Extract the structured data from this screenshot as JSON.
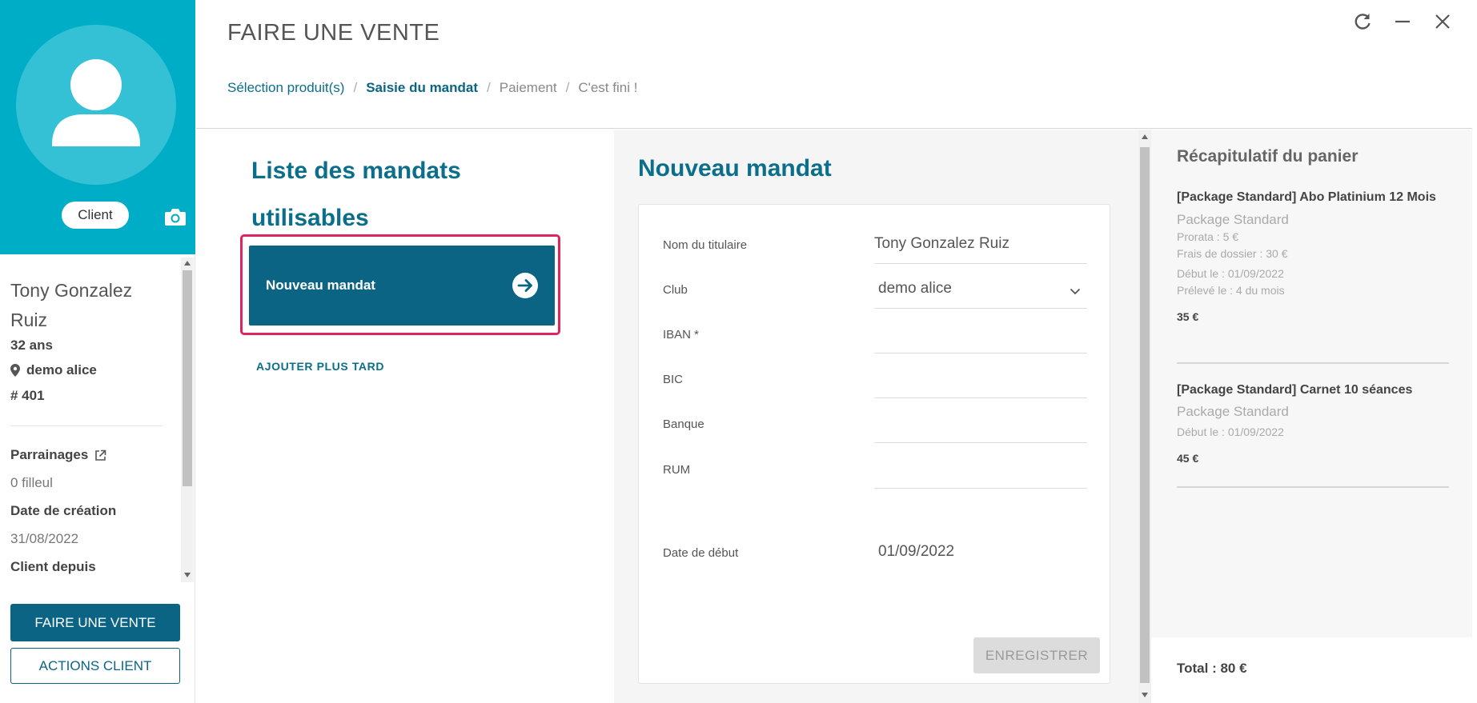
{
  "sidebar": {
    "client_badge": "Client",
    "client_name": "Tony Gonzalez Ruiz",
    "age": "32 ans",
    "club": "demo alice",
    "client_id": "# 401",
    "referrals_label": "Parrainages",
    "referrals_value": "0 filleul",
    "created_label": "Date de création",
    "created_value": "31/08/2022",
    "since_label": "Client depuis",
    "sale_button": "FAIRE UNE VENTE",
    "actions_button": "ACTIONS CLIENT"
  },
  "header": {
    "title": "FAIRE UNE VENTE",
    "breadcrumb": [
      {
        "label": "Sélection produit(s)",
        "state": "done"
      },
      {
        "label": "Saisie du mandat",
        "state": "active"
      },
      {
        "label": "Paiement",
        "state": "pending"
      },
      {
        "label": "C'est fini !",
        "state": "pending"
      }
    ],
    "separator": "/"
  },
  "mandates": {
    "title": "Liste des mandats utilisables",
    "new_mandate_card": "Nouveau mandat",
    "add_later": "AJOUTER PLUS TARD"
  },
  "form": {
    "title": "Nouveau mandat",
    "fields": [
      {
        "label": "Nom du titulaire",
        "value": "Tony Gonzalez Ruiz"
      },
      {
        "label": "Club",
        "value": "demo alice"
      },
      {
        "label": "IBAN *",
        "value": ""
      },
      {
        "label": "BIC",
        "value": ""
      },
      {
        "label": "Banque",
        "value": ""
      },
      {
        "label": "RUM",
        "value": ""
      },
      {
        "label": "Date de début",
        "value": "01/09/2022"
      }
    ],
    "save_button": "ENREGISTRER"
  },
  "cart": {
    "title": "Récapitulatif du panier",
    "items": [
      {
        "name": "[Package Standard] Abo Platinium 12 Mois",
        "package": "Package Standard",
        "details": [
          "Prorata : 5 €",
          "Frais de dossier : 30 €",
          "Début le : 01/09/2022",
          "Prélevé le : 4 du mois"
        ],
        "price": "35 €"
      },
      {
        "name": "[Package Standard] Carnet 10 séances",
        "package": "Package Standard",
        "details": [
          "Début le : 01/09/2022"
        ],
        "price": "45 €"
      }
    ],
    "total": "Total : 80 €"
  },
  "colors": {
    "brand_cyan": "#00adc7",
    "brand_dark": "#0b6484",
    "highlight": "#e0245e"
  }
}
